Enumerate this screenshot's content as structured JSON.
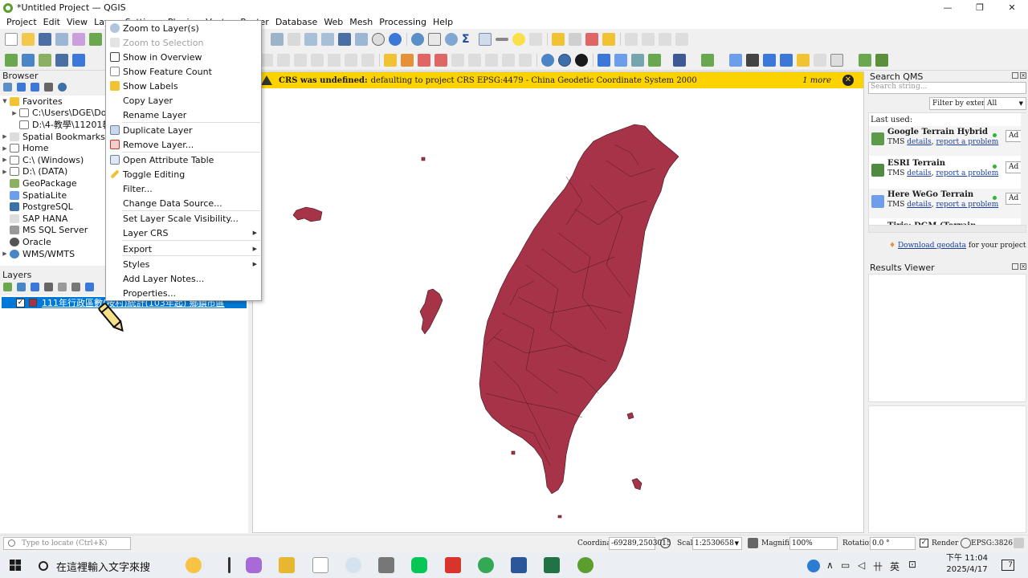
{
  "window": {
    "title": "*Untitled Project — QGIS"
  },
  "menubar": [
    "Project",
    "Edit",
    "View",
    "Layer",
    "Settings",
    "Plugins",
    "Vector",
    "Raster",
    "Database",
    "Web",
    "Mesh",
    "Processing",
    "Help"
  ],
  "browser": {
    "title": "Browser",
    "items": [
      {
        "label": "Favorites",
        "icon": "star-icon",
        "expanded": true
      },
      {
        "label": "C:\\Users\\DGE\\Dow",
        "icon": "folder-icon"
      },
      {
        "label": "D:\\4-教學\\11201教",
        "icon": "folder-icon"
      },
      {
        "label": "Spatial Bookmarks",
        "icon": "bookmark-icon"
      },
      {
        "label": "Home",
        "icon": "folder-icon"
      },
      {
        "label": "C:\\ (Windows)",
        "icon": "drive-icon"
      },
      {
        "label": "D:\\ (DATA)",
        "icon": "drive-icon"
      },
      {
        "label": "GeoPackage",
        "icon": "geopackage-icon"
      },
      {
        "label": "SpatiaLite",
        "icon": "spatialite-icon"
      },
      {
        "label": "PostgreSQL",
        "icon": "postgresql-icon"
      },
      {
        "label": "SAP HANA",
        "icon": "sap-hana-icon"
      },
      {
        "label": "MS SQL Server",
        "icon": "mssql-icon"
      },
      {
        "label": "Oracle",
        "icon": "oracle-icon"
      },
      {
        "label": "WMS/WMTS",
        "icon": "wms-icon"
      }
    ]
  },
  "layers": {
    "title": "Layers",
    "items": [
      {
        "name": "111年行政區數(按村)統計(103年起) 鄉鎮市區",
        "checked": true,
        "color": "#a73349"
      }
    ]
  },
  "context_menu": {
    "items": [
      {
        "label": "Zoom to Layer(s)",
        "icon": "zoom-layer-icon",
        "enabled": true
      },
      {
        "label": "Zoom to Selection",
        "icon": "zoom-selection-icon",
        "enabled": false
      },
      {
        "label": "Show in Overview",
        "icon": "overview-icon",
        "enabled": true
      },
      {
        "label": "Show Feature Count",
        "icon": "checkbox-icon",
        "enabled": true
      },
      {
        "label": "Show Labels",
        "icon": "labels-icon",
        "enabled": true
      },
      {
        "label": "Copy Layer",
        "enabled": true
      },
      {
        "label": "Rename Layer",
        "enabled": true
      },
      {
        "label": "Duplicate Layer",
        "icon": "duplicate-icon",
        "enabled": true
      },
      {
        "label": "Remove Layer...",
        "icon": "remove-icon",
        "enabled": true
      },
      {
        "label": "Open Attribute Table",
        "icon": "table-icon",
        "enabled": true
      },
      {
        "label": "Toggle Editing",
        "icon": "pencil-icon",
        "enabled": true
      },
      {
        "label": "Filter...",
        "enabled": true
      },
      {
        "label": "Change Data Source...",
        "enabled": true
      },
      {
        "label": "Set Layer Scale Visibility...",
        "enabled": true
      },
      {
        "label": "Layer CRS",
        "enabled": true,
        "submenu": true
      },
      {
        "label": "Export",
        "enabled": true,
        "submenu": true
      },
      {
        "label": "Styles",
        "enabled": true,
        "submenu": true
      },
      {
        "label": "Add Layer Notes...",
        "enabled": true
      },
      {
        "label": "Properties...",
        "enabled": true
      }
    ]
  },
  "crs_message": {
    "bold": "CRS was undefined:",
    "text": "defaulting to project CRS EPSG:4479 - China Geodetic Coordinate System 2000",
    "more": "1 more"
  },
  "qms": {
    "title": "Search QMS",
    "search_placeholder": "Search string...",
    "filter_button": "Filter by extent",
    "filter_select": "All",
    "last_used": "Last used:",
    "services": [
      {
        "name": "Google Terrain Hybrid",
        "type": "TMS",
        "details": "details",
        "report": "report a problem",
        "add": "Ad"
      },
      {
        "name": "ESRI Terrain",
        "type": "TMS",
        "details": "details",
        "report": "report a problem",
        "add": "Ad"
      },
      {
        "name": "Here WeGo Terrain",
        "type": "TMS",
        "details": "details",
        "report": "report a problem",
        "add": "Ad"
      },
      {
        "name": "Tiris: DGM (Terrain",
        "type": "",
        "details": "",
        "report": "",
        "add": ""
      }
    ],
    "download_link": "Download geodata",
    "download_suffix": "for your project"
  },
  "results_viewer": {
    "title": "Results Viewer"
  },
  "statusbar": {
    "locate_placeholder": "Type to locate (Ctrl+K)",
    "coordinate_label": "Coordinate",
    "coordinate_value": "-69289,2503015",
    "scale_label": "Scale",
    "scale_value": "1:2530658",
    "magnifier_label": "Magnifier",
    "magnifier_value": "100%",
    "rotation_label": "Rotation",
    "rotation_value": "0.0 °",
    "render_label": "Render",
    "render_checked": true,
    "crs": "EPSG:3826"
  },
  "taskbar": {
    "search_text": "在這裡輸入文字來搜",
    "ime": "英",
    "time": "下午 11:04",
    "date": "2025/4/17",
    "notifications": "7"
  },
  "colors": {
    "accent": "#0078d7",
    "layer_fill": "#a73349",
    "message_bar": "#fcd200"
  }
}
